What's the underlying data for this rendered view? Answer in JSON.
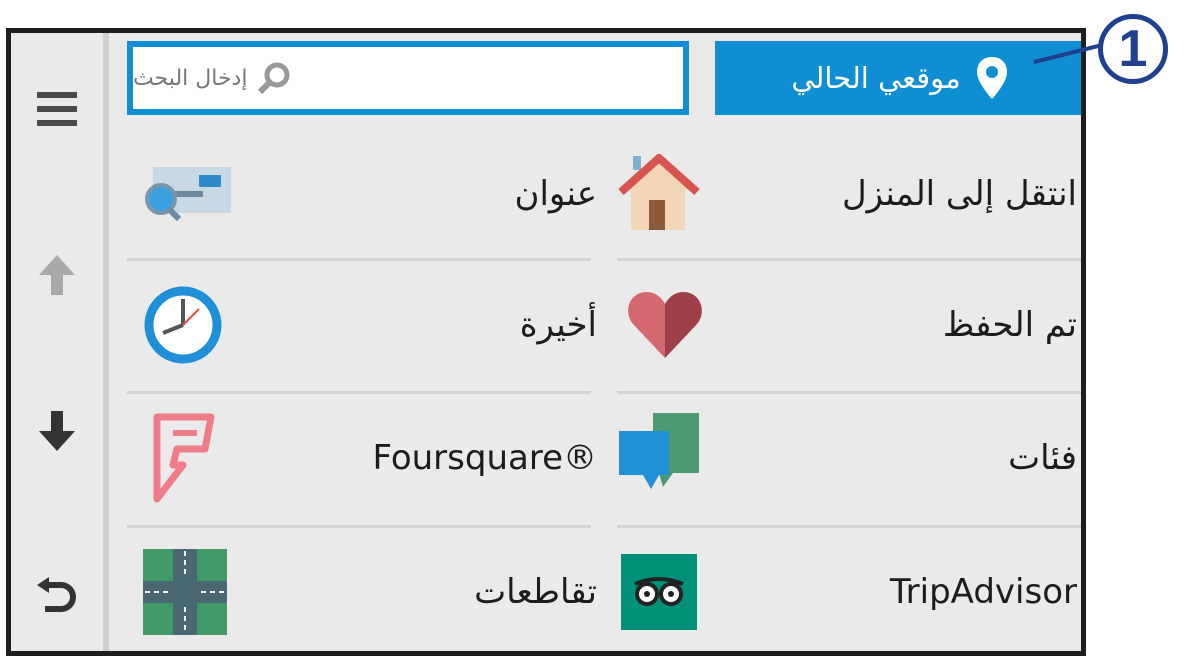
{
  "search": {
    "placeholder": "إدخال البحث"
  },
  "current_location": {
    "label": "موقعي الحالي"
  },
  "callout": {
    "number": "1"
  },
  "sidebar": {
    "menu": "menu-icon",
    "up": "arrow-up-icon",
    "down": "arrow-down-icon",
    "back": "back-icon"
  },
  "grid": {
    "go_home": "انتقل إلى المنزل",
    "address": "عنوان",
    "saved": "تم الحفظ",
    "recent": "أخيرة",
    "categories": "فئات",
    "foursquare": "Foursquare®",
    "tripadvisor": "TripAdvisor",
    "intersections": "تقاطعات"
  },
  "colors": {
    "accent": "#0f8ed3",
    "callout": "#1f3f8f",
    "heart": "#c9565c",
    "foursquare": "#ef7d88",
    "tripadvisor": "#00917a"
  }
}
